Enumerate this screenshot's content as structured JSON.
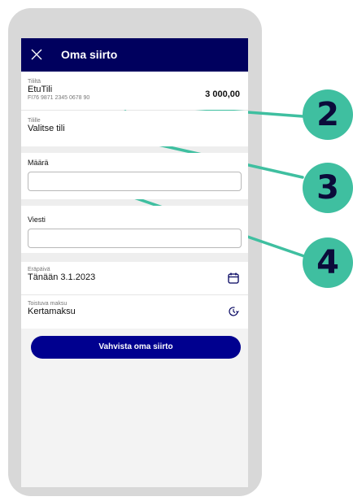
{
  "header": {
    "title": "Oma siirto",
    "close_icon": "close-icon"
  },
  "from_account": {
    "label": "Tililtä",
    "name": "EtuTili",
    "iban": "FI76 9871 2345 0678 90",
    "balance": "3 000,00"
  },
  "to_account": {
    "label": "Tilille",
    "value": "Valitse tili"
  },
  "amount": {
    "label": "Määrä",
    "value": ""
  },
  "message": {
    "label": "Viesti",
    "value": ""
  },
  "due_date": {
    "label": "Eräpäivä",
    "value": "Tänään 3.1.2023",
    "icon": "calendar-icon"
  },
  "recurring": {
    "label": "Toistuva maksu",
    "value": "Kertamaksu",
    "icon": "recurring-clock-icon"
  },
  "confirm_button": {
    "label": "Vahvista oma siirto"
  },
  "callouts": [
    "2",
    "3",
    "4"
  ],
  "colors": {
    "header": "#00005e",
    "button": "#00008f",
    "callout": "#3fbfa0"
  }
}
